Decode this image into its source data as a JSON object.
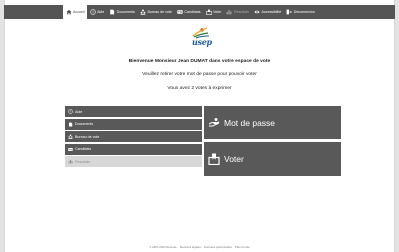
{
  "nav": {
    "items": [
      {
        "label": "Accueil",
        "icon": "home-icon",
        "state": "active"
      },
      {
        "label": "Aide",
        "icon": "help-icon",
        "state": "normal"
      },
      {
        "label": "Documents",
        "icon": "document-icon",
        "state": "normal"
      },
      {
        "label": "Bureau de vote",
        "icon": "people-icon",
        "state": "normal"
      },
      {
        "label": "Candidats",
        "icon": "id-card-icon",
        "state": "normal"
      },
      {
        "label": "Voter",
        "icon": "ballot-box-icon",
        "state": "normal"
      },
      {
        "label": "Résultats",
        "icon": "bar-chart-icon",
        "state": "disabled"
      },
      {
        "label": "Accessibilité",
        "icon": "eye-icon",
        "state": "normal"
      },
      {
        "label": "Déconnexion",
        "icon": "logout-icon",
        "state": "normal"
      }
    ]
  },
  "logo": {
    "text": "usep"
  },
  "welcome": {
    "line1": "Bienvenue Monsieur Jean DUMAT dans votre espace de vote",
    "line2": "Veuillez retirer votre mot de passe pour pouvoir voter",
    "line3": "Vous avez 2 votes à exprimer"
  },
  "menu": {
    "items": [
      {
        "label": "Aide",
        "icon": "help-icon"
      },
      {
        "label": "Documents",
        "icon": "document-icon"
      },
      {
        "label": "Bureau de vote",
        "icon": "people-icon"
      },
      {
        "label": "Candidats",
        "icon": "id-card-icon"
      },
      {
        "label": "Résultats",
        "icon": "bar-chart-icon"
      }
    ]
  },
  "actions": {
    "password": "Mot de passe",
    "vote": "Voter"
  },
  "footer": {
    "copyright": "© 2007-2024 Neovote",
    "legal": "Mentions légales",
    "privacy": "Données personnelles",
    "sitemap": "Plan du site"
  },
  "colors": {
    "dark": "#595959",
    "navbar": "#555555",
    "brand": "#1c5ba0",
    "disabled": "#d8d8d8"
  }
}
